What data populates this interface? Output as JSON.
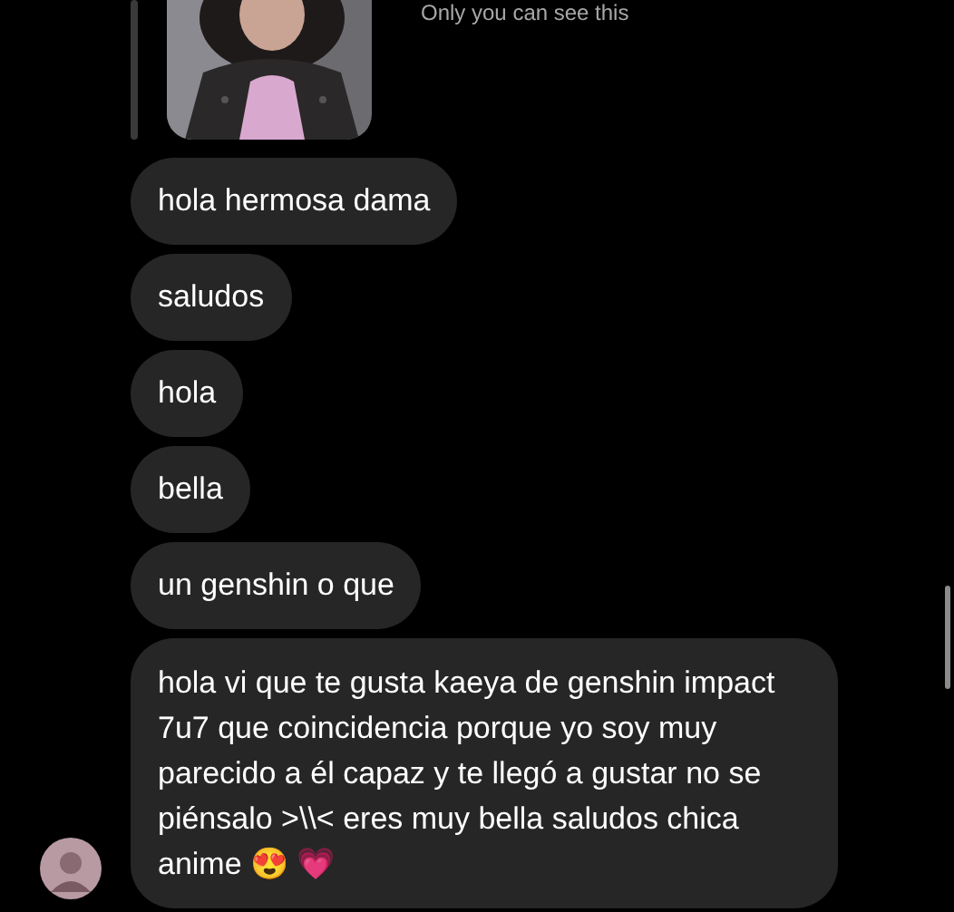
{
  "notice": "Only you can see this",
  "messages": [
    {
      "text": "hola hermosa dama",
      "show_avatar": false
    },
    {
      "text": "saludos",
      "show_avatar": false
    },
    {
      "text": "hola",
      "show_avatar": false
    },
    {
      "text": "bella",
      "show_avatar": false
    },
    {
      "text": "un genshin o que",
      "show_avatar": false
    },
    {
      "text": "hola vi que te gusta kaeya de genshin impact 7u7 que coincidencia porque yo soy muy parecido a él capaz y te llegó a gustar no se piénsalo >\\\\< eres muy bella saludos chica anime 😍 💗",
      "show_avatar": true
    }
  ]
}
